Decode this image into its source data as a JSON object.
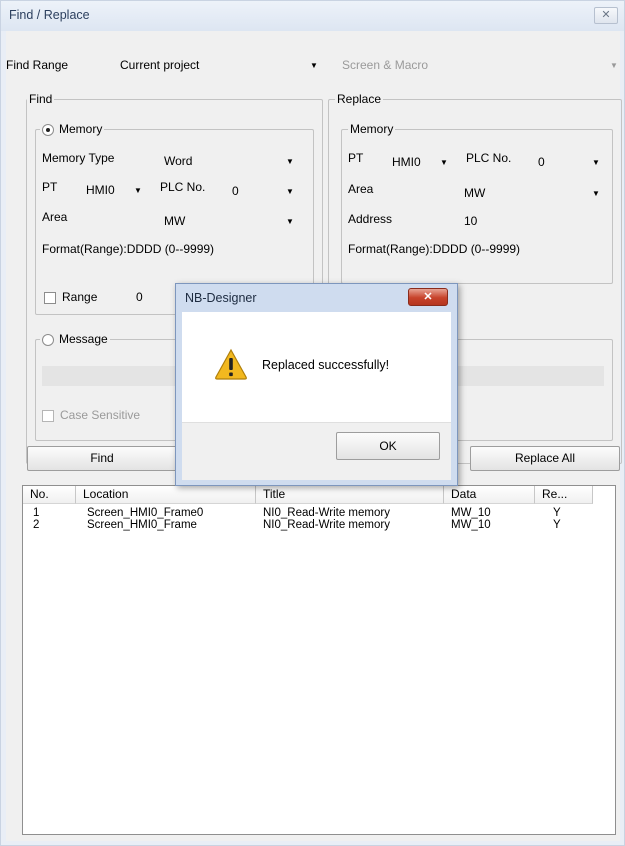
{
  "window": {
    "title": "Find / Replace",
    "close_glyph": "✕"
  },
  "find_range": {
    "label": "Find Range",
    "value": "Current project",
    "scope": "Screen & Macro"
  },
  "find": {
    "legend": "Find",
    "memory": {
      "legend": "Memory",
      "memory_type_label": "Memory Type",
      "memory_type_value": "Word",
      "pt_label": "PT",
      "pt_value": "HMI0",
      "plc_label": "PLC No.",
      "plc_value": "0",
      "area_label": "Area",
      "area_value": "MW",
      "format": "Format(Range):DDDD (0--9999)"
    },
    "range": {
      "label": "Range",
      "value": "0"
    },
    "message": {
      "legend": "Message"
    },
    "case_sensitive": "Case Sensitive"
  },
  "replace": {
    "legend": "Replace",
    "memory": {
      "legend": "Memory",
      "pt_label": "PT",
      "pt_value": "HMI0",
      "plc_label": "PLC No.",
      "plc_value": "0",
      "area_label": "Area",
      "area_value": "MW",
      "address_label": "Address",
      "address_value": "10",
      "format": "Format(Range):DDDD (0--9999)"
    }
  },
  "buttons": {
    "find": "Find",
    "replace_all": "Replace All"
  },
  "results": {
    "columns": [
      "No.",
      "Location",
      "Title",
      "Data",
      "Re..."
    ],
    "rows": [
      [
        "1",
        "Screen_HMI0_Frame0",
        "NI0_Read-Write memory",
        "MW_10",
        "Y"
      ],
      [
        "2",
        "Screen_HMI0_Frame",
        "NI0_Read-Write memory",
        "MW_10",
        "Y"
      ]
    ]
  },
  "dialog": {
    "title": "NB-Designer",
    "close_glyph": "✕",
    "icon": "warning-icon",
    "message": "Replaced successfully!",
    "ok": "OK"
  },
  "colors": {
    "accent": "#7d96bd",
    "close_red": "#c7432b",
    "warning": "#f2b81f"
  }
}
